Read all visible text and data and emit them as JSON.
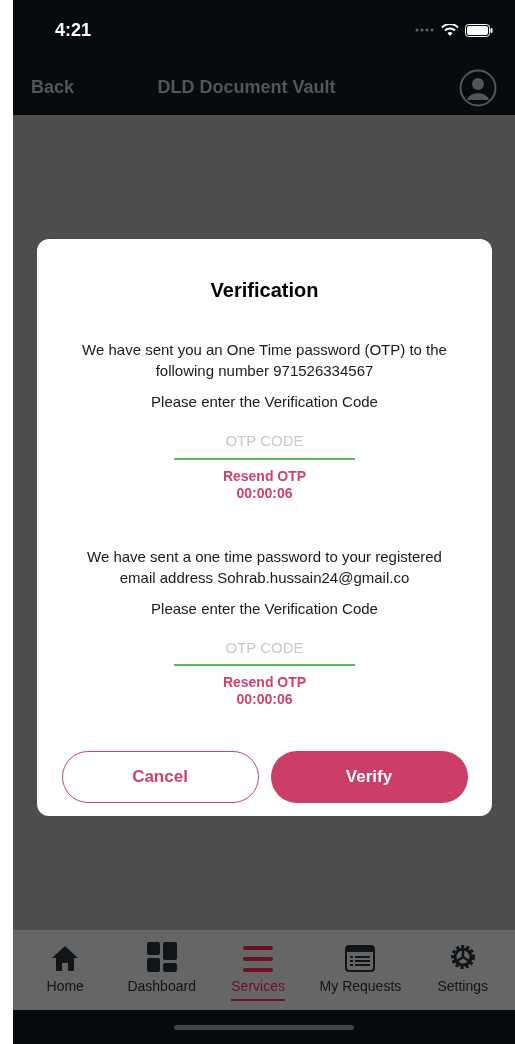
{
  "status_bar": {
    "time": "4:21"
  },
  "nav_bar": {
    "back": "Back",
    "title": "DLD Document Vault"
  },
  "dialog": {
    "title": "Verification",
    "sections": [
      {
        "message": "We have sent you an One Time password (OTP) to the following number 971526334567",
        "prompt": "Please enter the Verification Code",
        "placeholder": "OTP CODE",
        "resend": "Resend OTP",
        "timer": "00:00:06"
      },
      {
        "message": "We have sent a one time password to your registered email address Sohrab.hussain24@gmail.co",
        "prompt": "Please enter the Verification Code",
        "placeholder": "OTP CODE",
        "resend": "Resend OTP",
        "timer": "00:00:06"
      }
    ],
    "buttons": [
      {
        "kind": "outline",
        "label": "Cancel"
      },
      {
        "kind": "filled",
        "label": "Verify"
      }
    ]
  },
  "tab_bar": [
    {
      "kind": "home",
      "label": "Home",
      "selected": false
    },
    {
      "kind": "dashboard",
      "label": "Dashboard",
      "selected": false
    },
    {
      "kind": "services",
      "label": "Services",
      "selected": true
    },
    {
      "kind": "requests",
      "label": "My Requests",
      "selected": false
    },
    {
      "kind": "settings",
      "label": "Settings",
      "selected": false
    }
  ]
}
